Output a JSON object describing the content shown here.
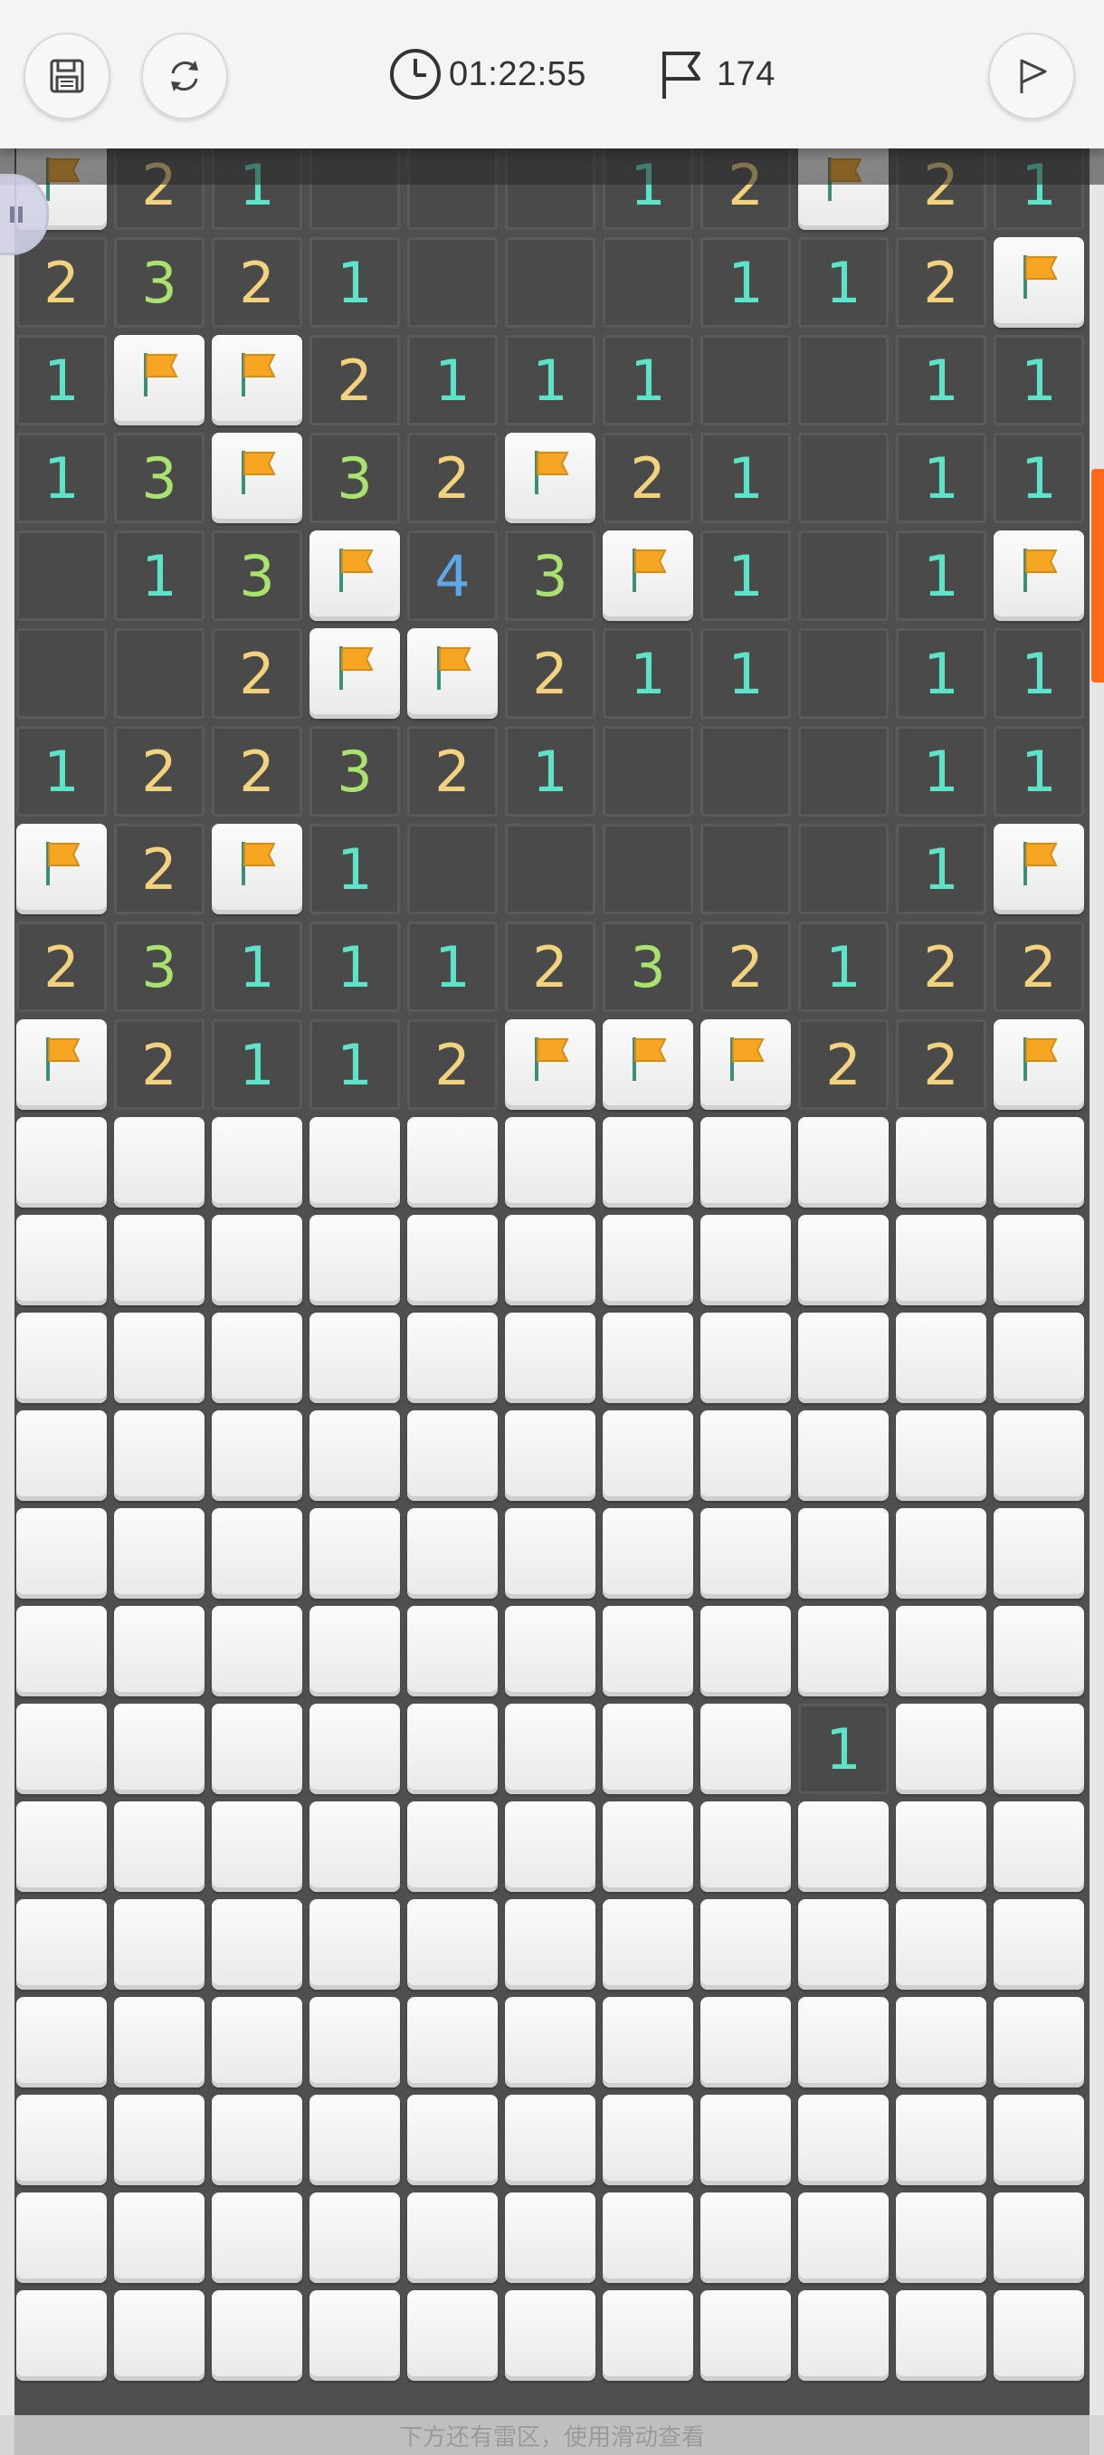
{
  "toolbar": {
    "timer": "01:22:55",
    "flags_left": "174",
    "icons": [
      "save-icon",
      "restart-icon",
      "clock-icon",
      "flag-counter-icon",
      "flag-mode-icon"
    ]
  },
  "board": {
    "cols": 11,
    "rows": [
      [
        "F",
        "2",
        "1",
        "O",
        "O",
        "O",
        "1",
        "2",
        "F",
        "2",
        "1"
      ],
      [
        "2",
        "3",
        "2",
        "1",
        "O",
        "O",
        "O",
        "1",
        "1",
        "2",
        "F"
      ],
      [
        "1",
        "F",
        "F",
        "2",
        "1",
        "1",
        "1",
        "O",
        "O",
        "1",
        "1"
      ],
      [
        "1",
        "3",
        "F",
        "3",
        "2",
        "F",
        "2",
        "1",
        "O",
        "1",
        "1"
      ],
      [
        "O",
        "1",
        "3",
        "F",
        "4",
        "3",
        "F",
        "1",
        "O",
        "1",
        "F"
      ],
      [
        "O",
        "O",
        "2",
        "F",
        "F",
        "2",
        "1",
        "1",
        "O",
        "1",
        "1"
      ],
      [
        "1",
        "2",
        "2",
        "3",
        "2",
        "1",
        "O",
        "O",
        "O",
        "1",
        "1"
      ],
      [
        "F",
        "2",
        "F",
        "1",
        "O",
        "O",
        "O",
        "O",
        "O",
        "1",
        "F"
      ],
      [
        "2",
        "3",
        "1",
        "1",
        "1",
        "2",
        "3",
        "2",
        "1",
        "2",
        "2"
      ],
      [
        "F",
        "2",
        "1",
        "1",
        "2",
        "F",
        "F",
        "F",
        "2",
        "2",
        "F"
      ],
      [
        "C",
        "C",
        "C",
        "C",
        "C",
        "C",
        "C",
        "C",
        "C",
        "C",
        "C"
      ],
      [
        "C",
        "C",
        "C",
        "C",
        "C",
        "C",
        "C",
        "C",
        "C",
        "C",
        "C"
      ],
      [
        "C",
        "C",
        "C",
        "C",
        "C",
        "C",
        "C",
        "C",
        "C",
        "C",
        "C"
      ],
      [
        "C",
        "C",
        "C",
        "C",
        "C",
        "C",
        "C",
        "C",
        "C",
        "C",
        "C"
      ],
      [
        "C",
        "C",
        "C",
        "C",
        "C",
        "C",
        "C",
        "C",
        "C",
        "C",
        "C"
      ],
      [
        "C",
        "C",
        "C",
        "C",
        "C",
        "C",
        "C",
        "C",
        "C",
        "C",
        "C"
      ],
      [
        "C",
        "C",
        "C",
        "C",
        "C",
        "C",
        "C",
        "C",
        "1",
        "C",
        "C"
      ],
      [
        "C",
        "C",
        "C",
        "C",
        "C",
        "C",
        "C",
        "C",
        "C",
        "C",
        "C"
      ],
      [
        "C",
        "C",
        "C",
        "C",
        "C",
        "C",
        "C",
        "C",
        "C",
        "C",
        "C"
      ],
      [
        "C",
        "C",
        "C",
        "C",
        "C",
        "C",
        "C",
        "C",
        "C",
        "C",
        "C"
      ],
      [
        "C",
        "C",
        "C",
        "C",
        "C",
        "C",
        "C",
        "C",
        "C",
        "C",
        "C"
      ],
      [
        "C",
        "C",
        "C",
        "C",
        "C",
        "C",
        "C",
        "C",
        "C",
        "C",
        "C"
      ],
      [
        "C",
        "C",
        "C",
        "C",
        "C",
        "C",
        "C",
        "C",
        "C",
        "C",
        "C"
      ]
    ],
    "colors": {
      "n1": "#5de3c7",
      "n2": "#f3d27e",
      "n3": "#a9e36e",
      "n4": "#5fa8e8",
      "flag": "#f6a623"
    }
  },
  "hint": "下方还有雷区，使用滑动查看"
}
